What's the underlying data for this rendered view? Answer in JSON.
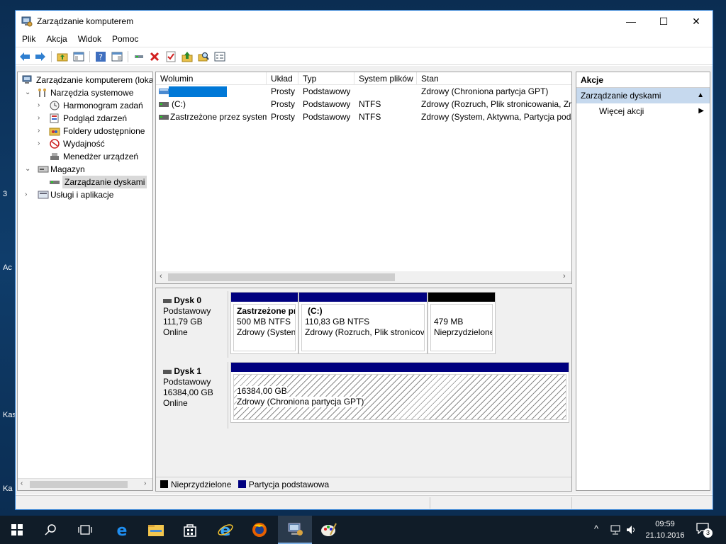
{
  "desktop": {
    "labels": [
      "3",
      "Ac",
      "Kas",
      "Ka"
    ]
  },
  "window": {
    "title": "Zarządzanie komputerem",
    "controls": {
      "minimize": "—",
      "maximize": "☐",
      "close": "✕"
    }
  },
  "menu": [
    "Plik",
    "Akcja",
    "Widok",
    "Pomoc"
  ],
  "tree": {
    "items": [
      {
        "label": "Zarządzanie komputerem (loka",
        "icon": "computer-icon"
      },
      {
        "label": "Narzędzia systemowe",
        "icon": "tools-icon"
      },
      {
        "label": "Harmonogram zadań",
        "icon": "clock-icon"
      },
      {
        "label": "Podgląd zdarzeń",
        "icon": "event-viewer-icon"
      },
      {
        "label": "Foldery udostępnione",
        "icon": "shared-folder-icon"
      },
      {
        "label": "Wydajność",
        "icon": "performance-icon"
      },
      {
        "label": "Menedżer urządzeń",
        "icon": "device-manager-icon"
      },
      {
        "label": "Magazyn",
        "icon": "storage-icon"
      },
      {
        "label": "Zarządzanie dyskami",
        "icon": "disk-icon"
      },
      {
        "label": "Usługi i aplikacje",
        "icon": "services-icon"
      }
    ]
  },
  "volumes": {
    "columns": [
      "Wolumin",
      "Układ",
      "Typ",
      "System plików",
      "Stan"
    ],
    "rows": [
      {
        "name": "",
        "layout": "Prosty",
        "type": "Podstawowy",
        "fs": "",
        "status": "Zdrowy (Chroniona partycja GPT)"
      },
      {
        "name": "(C:)",
        "layout": "Prosty",
        "type": "Podstawowy",
        "fs": "NTFS",
        "status": "Zdrowy (Rozruch, Plik stronicowania, Zrz"
      },
      {
        "name": "Zastrzeżone przez system",
        "layout": "Prosty",
        "type": "Podstawowy",
        "fs": "NTFS",
        "status": "Zdrowy (System, Aktywna, Partycja pods"
      }
    ]
  },
  "disks": [
    {
      "name": "Dysk 0",
      "type": "Podstawowy",
      "size": "111,79 GB",
      "state": "Online",
      "partitions": [
        {
          "title": "Zastrzeżone pr",
          "size": "500 MB NTFS",
          "status": "Zdrowy (Systen"
        },
        {
          "title": "(C:)",
          "size": "110,83 GB NTFS",
          "status": "Zdrowy (Rozruch, Plik stronicov"
        },
        {
          "title": "",
          "size": "479 MB",
          "status": "Nieprzydzielone"
        }
      ]
    },
    {
      "name": "Dysk 1",
      "type": "Podstawowy",
      "size": "16384,00 GB",
      "state": "Online",
      "partitions": [
        {
          "title": "",
          "size": "16384,00 GB",
          "status": "Zdrowy (Chroniona partycja GPT)"
        }
      ]
    }
  ],
  "legend": [
    "Nieprzydzielone",
    "Partycja podstawowa"
  ],
  "actions": {
    "header": "Akcje",
    "section": "Zarządzanie dyskami",
    "item": "Więcej akcji"
  },
  "taskbar": {
    "time": "09:59",
    "date": "21.10.2016",
    "notifications": "3"
  },
  "colors": {
    "primary_partition": "#00007f",
    "unallocated": "#000000",
    "selection": "#0078d7",
    "accent": "#2b7dd3"
  }
}
